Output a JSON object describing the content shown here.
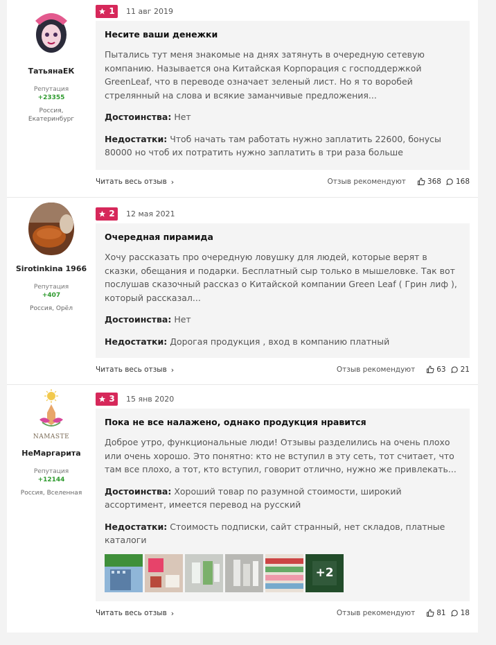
{
  "reviews": [
    {
      "author": "ТатьянаЕК",
      "reputation_label": "Репутация",
      "reputation": "+23355",
      "city": "Россия, Екатеринбург",
      "rating": "1",
      "date": "11 авг 2019",
      "title": "Несите ваши денежки",
      "text": "Пытались тут меня знакомые на днях затянуть в очередную сетевую компанию. Называется она Китайская Корпорация с господдержкой GreenLeaf, что в переводе означает зеленый лист. Но я то воробей стрелянный на слова и всякие заманчивые предложения...",
      "pros_label": "Достоинства:",
      "pros": "Нет",
      "cons_label": "Недостатки:",
      "cons": "Чтоб начать там работать нужно заплатить 22600, бонусы 80000 но чтоб их потратить нужно заплатить в три раза больше",
      "read_more": "Читать весь отзыв",
      "recommend": "Отзыв рекомендуют",
      "likes": "368",
      "comments": "168"
    },
    {
      "author": "Sirotinkina 1966",
      "reputation_label": "Репутация",
      "reputation": "+407",
      "city": "Россия, Орёл",
      "rating": "2",
      "date": "12 мая 2021",
      "title": "Очередная пирамида",
      "text": "Хочу рассказать про очередную ловушку для людей, которые верят в сказки, обещания и подарки. Бесплатный сыр только в мышеловке. Так вот послушав сказочный рассказ о Китайской компании Green Leaf ( Грин лиф ), который рассказал...",
      "pros_label": "Достоинства:",
      "pros": "Нет",
      "cons_label": "Недостатки:",
      "cons": "Дорогая продукция , вход в компанию платный",
      "read_more": "Читать весь отзыв",
      "recommend": "Отзыв рекомендуют",
      "likes": "63",
      "comments": "21"
    },
    {
      "author": "НеМаргарита",
      "reputation_label": "Репутация",
      "reputation": "+12144",
      "city": "Россия, Вселенная",
      "avatar_caption": "NAMASTE",
      "rating": "3",
      "date": "15 янв 2020",
      "title": "Пока не все налажено, однако продукция нравится",
      "text": "Доброе утро, функциональные люди! Отзывы разделились на очень плохо или очень хорошо. Это понятно: кто не вступил в эту сеть, тот считает, что там все плохо, а тот, кто вступил, говорит отлично, нужно же привлекать...",
      "pros_label": "Достоинства:",
      "pros": "Хороший товар по разумной стоимости, широкий ассортимент, имеется перевод на русский",
      "cons_label": "Недостатки:",
      "cons": "Стоимость подписки, сайт странный, нет складов, платные каталоги",
      "photo_more": "+2",
      "read_more": "Читать весь отзыв",
      "recommend": "Отзыв рекомендуют",
      "likes": "81",
      "comments": "18"
    }
  ],
  "colors": {
    "accent": "#d6285a",
    "reputation": "#2d9a2d",
    "box": "#f4f4f4"
  },
  "icons": {
    "rating": "star-icon",
    "likes": "thumb-up-icon",
    "comments": "comment-icon",
    "read_more": "chevron-right-icon"
  }
}
